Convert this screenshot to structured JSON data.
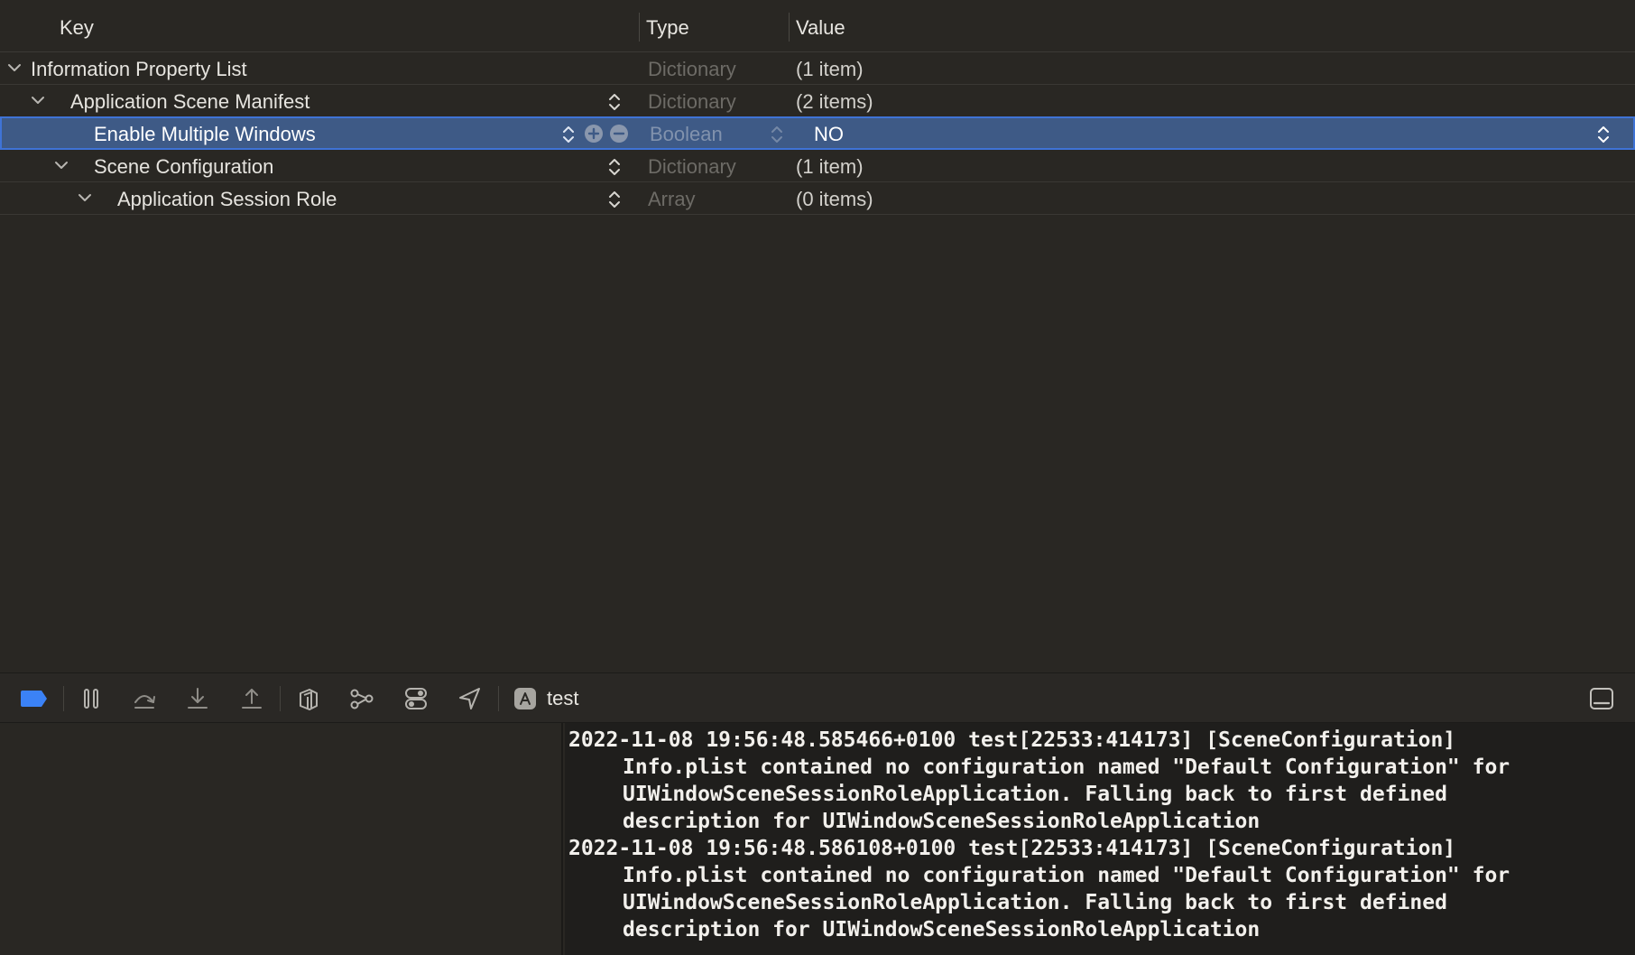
{
  "plist": {
    "headers": {
      "key": "Key",
      "type": "Type",
      "value": "Value"
    },
    "rows": [
      {
        "key": "Information Property List",
        "type": "Dictionary",
        "value": "(1 item)"
      },
      {
        "key": "Application Scene Manifest",
        "type": "Dictionary",
        "value": "(2 items)"
      },
      {
        "key": "Enable Multiple Windows",
        "type": "Boolean",
        "value": "NO"
      },
      {
        "key": "Scene Configuration",
        "type": "Dictionary",
        "value": "(1 item)"
      },
      {
        "key": "Application Session Role",
        "type": "Array",
        "value": "(0 items)"
      }
    ]
  },
  "debug_bar": {
    "target": "test",
    "icons": [
      "breakpoints-toggle-icon",
      "pause-icon",
      "step-over-icon",
      "step-into-icon",
      "step-out-icon",
      "view-hierarchy-icon",
      "memory-graph-icon",
      "environment-overrides-icon",
      "simulate-location-icon",
      "app-target-icon",
      "hide-panel-icon"
    ]
  },
  "console": {
    "lines": [
      "2022-11-08 19:56:48.585466+0100 test[22533:414173] [SceneConfiguration]",
      "Info.plist contained no configuration named \"Default Configuration\" for",
      "UIWindowSceneSessionRoleApplication. Falling back to first defined",
      "description for UIWindowSceneSessionRoleApplication",
      "2022-11-08 19:56:48.586108+0100 test[22533:414173] [SceneConfiguration]",
      "Info.plist contained no configuration named \"Default Configuration\" for",
      "UIWindowSceneSessionRoleApplication. Falling back to first defined",
      "description for UIWindowSceneSessionRoleApplication"
    ]
  },
  "colors": {
    "background": "#292723",
    "selection": "#3e5a86",
    "selection_border": "#3f73d6",
    "accent": "#3b82f6",
    "console_bg": "#1f1e1c"
  }
}
